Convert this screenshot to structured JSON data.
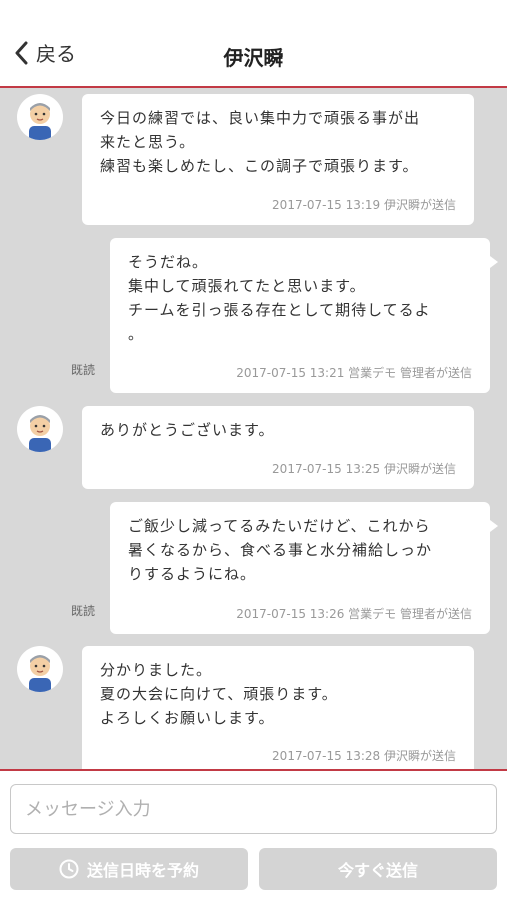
{
  "header": {
    "back_label": "戻る",
    "title": "伊沢瞬"
  },
  "messages": [
    {
      "side": "left",
      "text": "今日の練習では、良い集中力で頑張る事が出\n来たと思う。\n練習も楽しめたし、この調子で頑張ります。",
      "meta": "2017-07-15 13:19 伊沢瞬が送信"
    },
    {
      "side": "right",
      "text": "そうだね。\n集中して頑張れてたと思います。\nチームを引っ張る存在として期待してるよ\n。",
      "meta": "2017-07-15 13:21 営業デモ 管理者が送信",
      "read": "既読"
    },
    {
      "side": "left",
      "text": "ありがとうございます。",
      "meta": "2017-07-15 13:25 伊沢瞬が送信"
    },
    {
      "side": "right",
      "text": "ご飯少し減ってるみたいだけど、これから\n暑くなるから、食べる事と水分補給しっか\nりするようにね。",
      "meta": "2017-07-15 13:26 営業デモ 管理者が送信",
      "read": "既読"
    },
    {
      "side": "left",
      "text": "分かりました。\n夏の大会に向けて、頑張ります。\nよろしくお願いします。",
      "meta": "2017-07-15 13:28 伊沢瞬が送信"
    }
  ],
  "composer": {
    "placeholder": "メッセージ入力",
    "schedule_label": "送信日時を予約",
    "send_label": "今すぐ送信"
  },
  "colors": {
    "accent": "#c23a45",
    "chat_bg": "#d8d8d8",
    "bubble_bg": "#ffffff",
    "button_disabled": "#d4d4d4"
  },
  "icons": [
    "chevron-left-icon",
    "user-avatar-icon",
    "clock-icon"
  ]
}
